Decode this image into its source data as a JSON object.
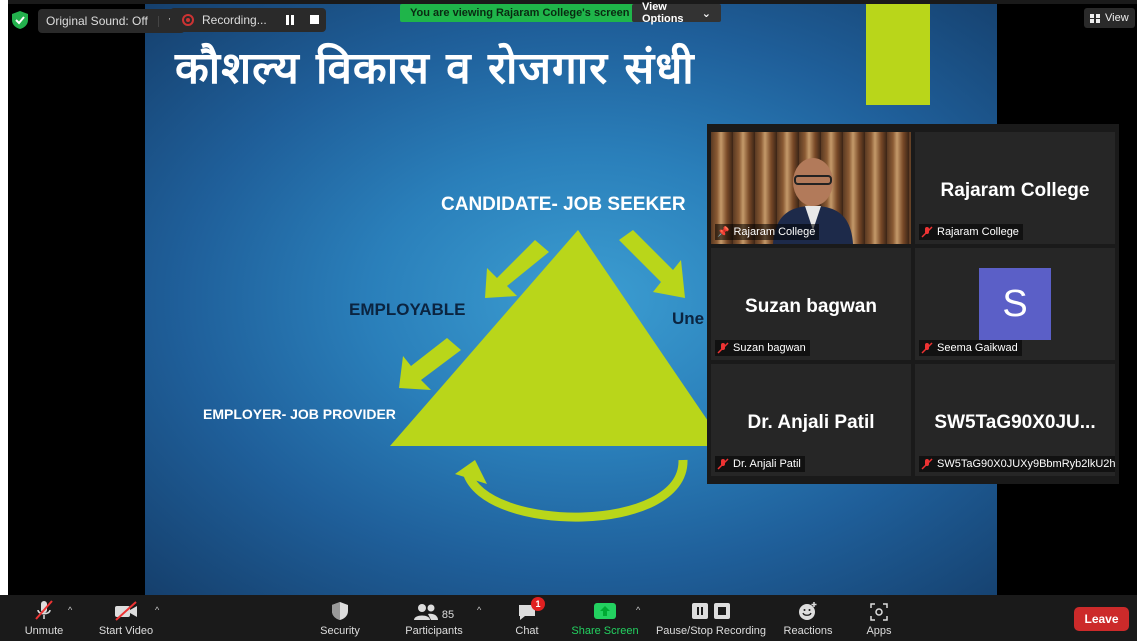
{
  "top_bar": {
    "original_sound": "Original Sound: Off",
    "recording": "Recording...",
    "viewing_banner": "You are viewing Rajaram College's screen",
    "view_options": "View Options",
    "view_label": "View"
  },
  "slide": {
    "title": "कौशल्य विकास व रोजगार संधी",
    "candidate_label": "CANDIDATE-   JOB SEEKER",
    "employable_label": "EMPLOYABLE",
    "unemployable_partial": "Une",
    "employer_label": "EMPLOYER- JOB PROVIDER"
  },
  "participants": [
    {
      "display": "",
      "tag": "Rajaram College",
      "video": true,
      "pinned": true
    },
    {
      "display": "Rajaram College",
      "tag": "Rajaram College",
      "video": false
    },
    {
      "display": "Suzan bagwan",
      "tag": "Suzan bagwan",
      "video": false
    },
    {
      "display": "S",
      "tag": "Seema Gaikwad",
      "video": false,
      "avatar": true
    },
    {
      "display": "Dr. Anjali Patil",
      "tag": "Dr. Anjali Patil",
      "video": false
    },
    {
      "display": "SW5TaG90X0JU...",
      "tag": "SW5TaG90X0JUXy9BbmRyb2lkU2h...",
      "video": false
    }
  ],
  "toolbar": {
    "unmute": "Unmute",
    "start_video": "Start Video",
    "security": "Security",
    "participants": "Participants",
    "participant_count": "85",
    "chat": "Chat",
    "chat_badge": "1",
    "share_screen": "Share Screen",
    "pause_stop_recording": "Pause/Stop Recording",
    "reactions": "Reactions",
    "apps": "Apps",
    "leave": "Leave"
  },
  "colors": {
    "accent_green": "#1fb54a",
    "slide_yellow_green": "#b9d61a",
    "leave_red": "#cc2a2a",
    "avatar_purple": "#5b5fc7"
  }
}
